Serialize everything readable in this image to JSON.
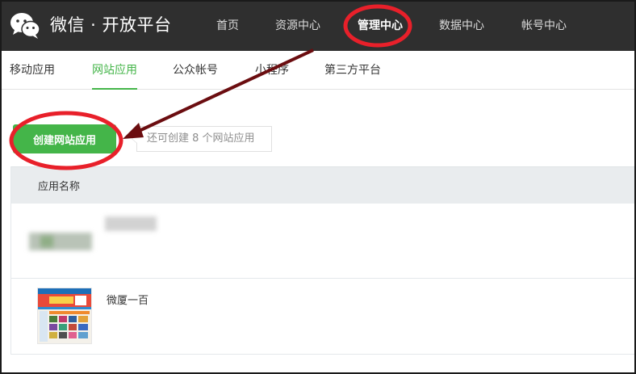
{
  "brand": {
    "title": "微信 · 开放平台",
    "logo_icon": "wechat-logo-icon"
  },
  "top_nav": [
    {
      "label": "首页"
    },
    {
      "label": "资源中心"
    },
    {
      "label": "管理中心",
      "active": true
    },
    {
      "label": "数据中心"
    },
    {
      "label": "帐号中心"
    }
  ],
  "sub_nav": [
    {
      "label": "移动应用"
    },
    {
      "label": "网站应用",
      "active": true
    },
    {
      "label": "公众帐号"
    },
    {
      "label": "小程序"
    },
    {
      "label": "第三方平台"
    }
  ],
  "create": {
    "button_label": "创建网站应用",
    "tip": "还可创建 8 个网站应用"
  },
  "table": {
    "header": "应用名称",
    "rows": [
      {
        "name": ""
      },
      {
        "name": "微厦一百"
      }
    ]
  },
  "colors": {
    "topbar": "#2f2f2f",
    "accent_green": "#44b549",
    "annotation_red": "#e8202a",
    "arrow": "#6b0d10"
  }
}
